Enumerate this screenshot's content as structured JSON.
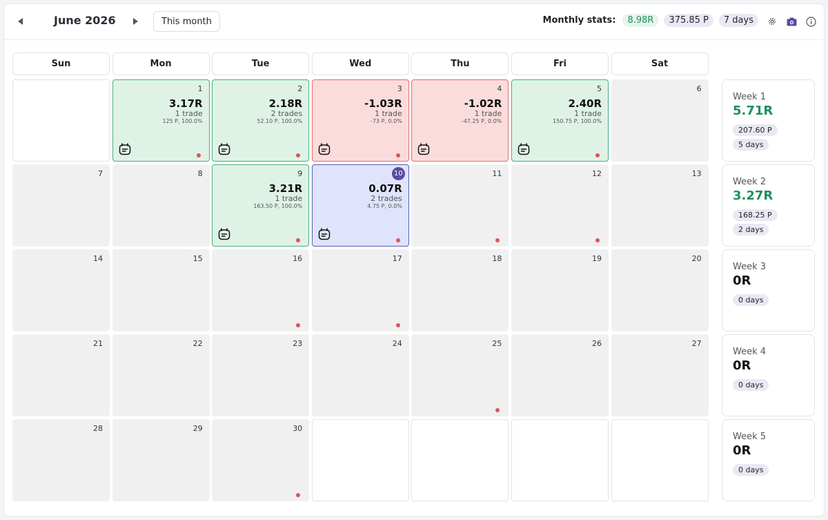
{
  "header": {
    "month_title": "June 2026",
    "this_month_label": "This month",
    "stats_label": "Monthly stats:",
    "stats_r": "8.98R",
    "stats_points": "375.85 P",
    "stats_days": "7 days"
  },
  "weekdays": [
    "Sun",
    "Mon",
    "Tue",
    "Wed",
    "Thu",
    "Fri",
    "Sat"
  ],
  "days": [
    {
      "n": "",
      "state": "empty"
    },
    {
      "n": "1",
      "state": "green",
      "r": "3.17R",
      "trades": "1 trade",
      "detail": "125 P, 100.0%",
      "note": true,
      "dot": true
    },
    {
      "n": "2",
      "state": "green",
      "r": "2.18R",
      "trades": "2 trades",
      "detail": "52.10 P, 100.0%",
      "note": true,
      "dot": true
    },
    {
      "n": "3",
      "state": "red",
      "r": "-1.03R",
      "trades": "1 trade",
      "detail": "-73 P, 0.0%",
      "note": true,
      "dot": true
    },
    {
      "n": "4",
      "state": "red",
      "r": "-1.02R",
      "trades": "1 trade",
      "detail": "-47.25 P, 0.0%",
      "note": true,
      "dot": false
    },
    {
      "n": "5",
      "state": "green",
      "r": "2.40R",
      "trades": "1 trade",
      "detail": "150.75 P, 100.0%",
      "note": true,
      "dot": true
    },
    {
      "n": "6",
      "state": "plain"
    },
    {
      "n": "7",
      "state": "plain"
    },
    {
      "n": "8",
      "state": "plain"
    },
    {
      "n": "9",
      "state": "green",
      "r": "3.21R",
      "trades": "1 trade",
      "detail": "163.50 P, 100.0%",
      "note": true,
      "dot": true
    },
    {
      "n": "10",
      "state": "blue",
      "today": true,
      "r": "0.07R",
      "trades": "2 trades",
      "detail": "4.75 P, 0.0%",
      "note": true,
      "dot": true
    },
    {
      "n": "11",
      "state": "plain",
      "dot": true
    },
    {
      "n": "12",
      "state": "plain",
      "dot": true
    },
    {
      "n": "13",
      "state": "plain"
    },
    {
      "n": "14",
      "state": "plain"
    },
    {
      "n": "15",
      "state": "plain"
    },
    {
      "n": "16",
      "state": "plain",
      "dot": true
    },
    {
      "n": "17",
      "state": "plain",
      "dot": true
    },
    {
      "n": "18",
      "state": "plain"
    },
    {
      "n": "19",
      "state": "plain"
    },
    {
      "n": "20",
      "state": "plain"
    },
    {
      "n": "21",
      "state": "plain"
    },
    {
      "n": "22",
      "state": "plain"
    },
    {
      "n": "23",
      "state": "plain"
    },
    {
      "n": "24",
      "state": "plain"
    },
    {
      "n": "25",
      "state": "plain",
      "dot": true
    },
    {
      "n": "26",
      "state": "plain"
    },
    {
      "n": "27",
      "state": "plain"
    },
    {
      "n": "28",
      "state": "plain"
    },
    {
      "n": "29",
      "state": "plain"
    },
    {
      "n": "30",
      "state": "plain",
      "dot": true
    },
    {
      "n": "",
      "state": "empty"
    },
    {
      "n": "",
      "state": "empty"
    },
    {
      "n": "",
      "state": "empty"
    },
    {
      "n": "",
      "state": "empty"
    }
  ],
  "weeks": [
    {
      "label": "Week 1",
      "r": "5.71R",
      "positive": true,
      "points": "207.60 P",
      "days": "5 days"
    },
    {
      "label": "Week 2",
      "r": "3.27R",
      "positive": true,
      "points": "168.25 P",
      "days": "2 days"
    },
    {
      "label": "Week 3",
      "r": "0R",
      "positive": false,
      "points": "",
      "days": "0 days"
    },
    {
      "label": "Week 4",
      "r": "0R",
      "positive": false,
      "points": "",
      "days": "0 days"
    },
    {
      "label": "Week 5",
      "r": "0R",
      "positive": false,
      "points": "",
      "days": "0 days"
    }
  ],
  "icons": {
    "prev": "chevron-left-icon",
    "next": "chevron-right-icon",
    "settings": "gear-icon",
    "camera": "camera-icon",
    "info": "info-icon",
    "note": "journal-note-icon"
  },
  "colors": {
    "green_cell": "#dff2e6",
    "red_cell": "#fbdcdc",
    "blue_cell": "#dfe3fb",
    "today_badge": "#5a4aa2",
    "positive_text": "#1f8f5f",
    "dot": "#e05353"
  }
}
